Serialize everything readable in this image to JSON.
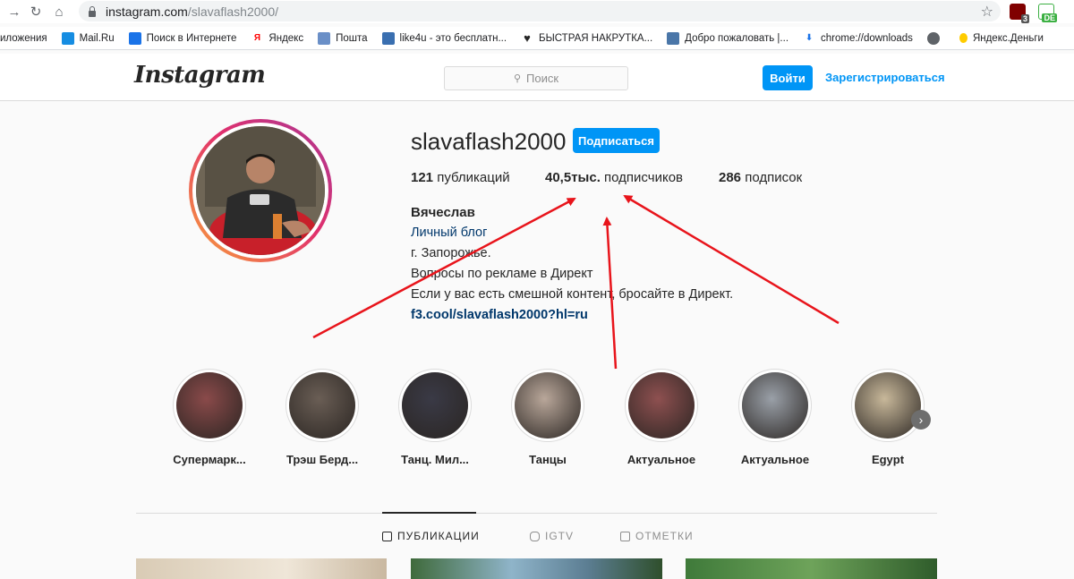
{
  "browser": {
    "url_host": "instagram.com",
    "url_path": "/slavaflash2000/",
    "ext_badge_1": "3",
    "ext_badge_2": "DE"
  },
  "bookmarks": [
    {
      "label": "иложения",
      "icon": "apps-icon",
      "color": "#ffffff"
    },
    {
      "label": "Mail.Ru",
      "icon": "mailru-icon",
      "color": "#168de2"
    },
    {
      "label": "Поиск в Интернете",
      "icon": "search-icon",
      "color": "#1a73e8"
    },
    {
      "label": "Яндекс",
      "icon": "yandex-icon",
      "color": "#ff0000"
    },
    {
      "label": "Пошта",
      "icon": "mail-icon",
      "color": "#6a8fc7"
    },
    {
      "label": "like4u - это бесплатн...",
      "icon": "like4u-icon",
      "color": "#3a6fb0"
    },
    {
      "label": "БЫСТРАЯ НАКРУТКА...",
      "icon": "heart-icon",
      "color": "#262626"
    },
    {
      "label": "Добро пожаловать |...",
      "icon": "vk-icon",
      "color": "#4a76a8"
    },
    {
      "label": "chrome://downloads",
      "icon": "download-icon",
      "color": "#1a73e8"
    },
    {
      "label": "",
      "icon": "globe-icon",
      "color": "#5f6368"
    },
    {
      "label": "Яндекс.Деньги",
      "icon": "yandex-money-icon",
      "color": "#ffcc00"
    }
  ],
  "header": {
    "logo": "Instagram",
    "search_placeholder": "Поиск",
    "login_label": "Войти",
    "signup_label": "Зарегистрироваться"
  },
  "profile": {
    "username": "slavaflash2000",
    "follow_label": "Подписаться",
    "posts_count": "121",
    "posts_label": " публикаций",
    "followers_count": "40,5тыс.",
    "followers_label": " подписчиков",
    "following_count": "286",
    "following_label": " подписок",
    "full_name": "Вячеслав",
    "category": "Личный блог",
    "bio_line_1": "г. Запорожье.",
    "bio_line_2": "Вопросы по рекламе в Директ",
    "bio_line_3": "Если у вас есть смешной контент, бросайте в Директ.",
    "link": "f3.cool/slavaflash2000?hl=ru"
  },
  "highlights": [
    {
      "label": "Супермарк...",
      "color": "#8a4a4a"
    },
    {
      "label": "Трэш Берд...",
      "color": "#6a5e55"
    },
    {
      "label": "Танц. Мил...",
      "color": "#3a3a46"
    },
    {
      "label": "Танцы",
      "color": "#b9a79a"
    },
    {
      "label": "Актуальное",
      "color": "#8e5050"
    },
    {
      "label": "Актуальное",
      "color": "#9aa0a8"
    },
    {
      "label": "Egypt",
      "color": "#c8b89a"
    }
  ],
  "tabs": [
    {
      "label": "ПУБЛИКАЦИИ",
      "icon": "grid-icon",
      "active": true
    },
    {
      "label": "IGTV",
      "icon": "igtv-icon",
      "active": false
    },
    {
      "label": "ОТМЕТКИ",
      "icon": "tagged-icon",
      "active": false
    }
  ],
  "colors": {
    "accent": "#0095f6",
    "link": "#00376b",
    "annotation_arrow": "#e8141b"
  }
}
